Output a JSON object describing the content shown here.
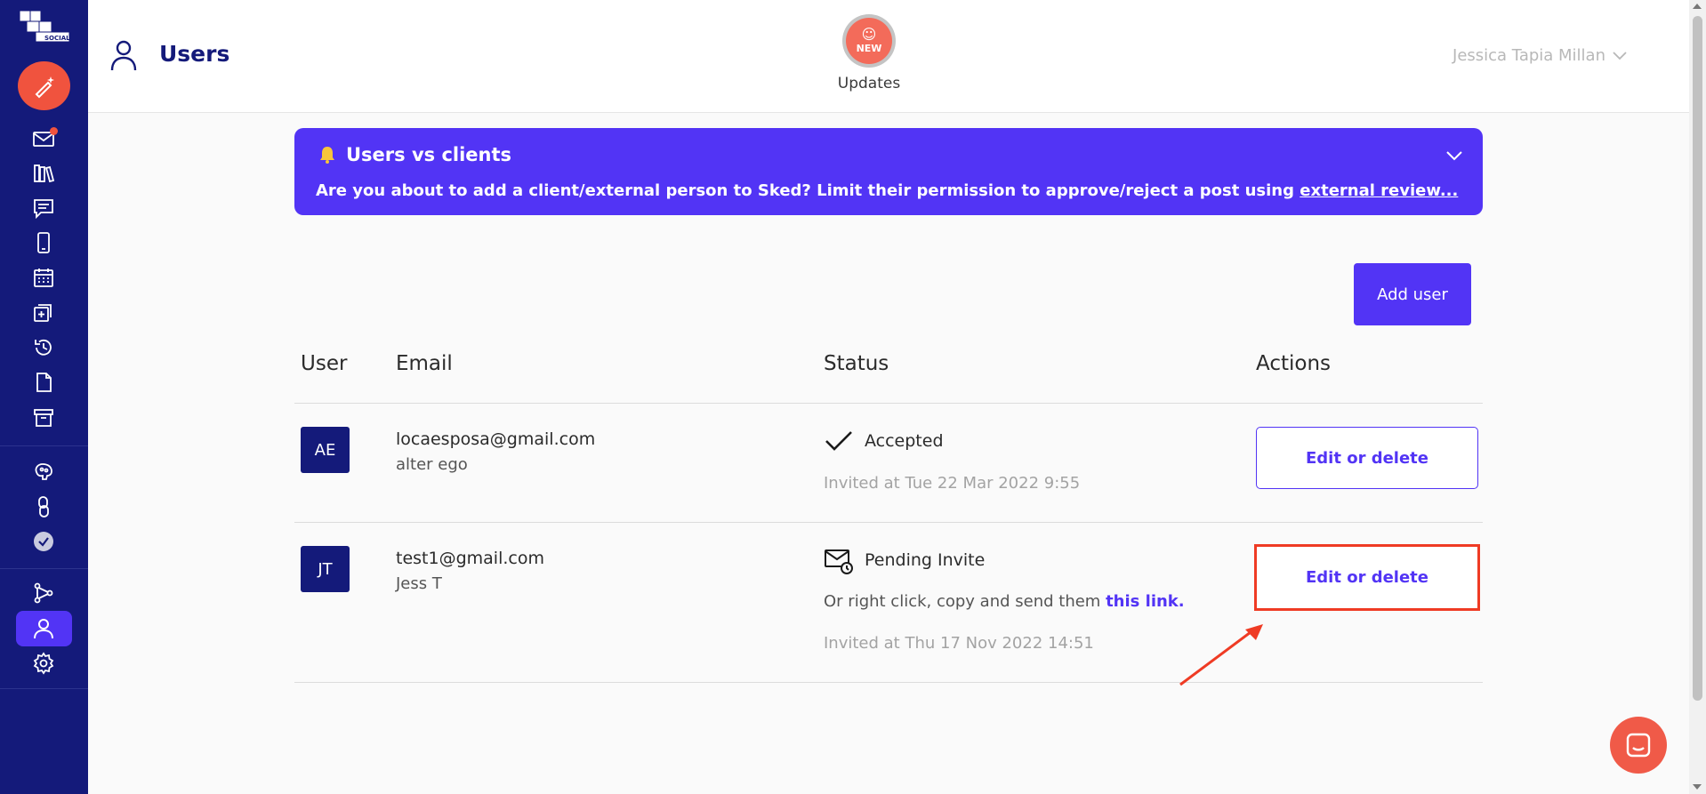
{
  "header": {
    "title": "Users",
    "updates_label": "Updates",
    "updates_badge": "NEW",
    "account_name": "Jessica Tapia Millan"
  },
  "banner": {
    "title": "Users vs clients",
    "text": "Are you about to add a client/external person to Sked? Limit their permission to approve/reject a post using ",
    "link": "external review..."
  },
  "toolbar": {
    "add_user_label": "Add user"
  },
  "table": {
    "columns": [
      "User",
      "Email",
      "Status",
      "Actions"
    ],
    "rows": [
      {
        "initials": "AE",
        "email": "locaesposa@gmail.com",
        "name": "alter ego",
        "status": "Accepted",
        "invited": "Invited at Tue 22 Mar 2022 9:55",
        "action": "Edit or delete"
      },
      {
        "initials": "JT",
        "email": "test1@gmail.com",
        "name": "Jess T",
        "status": "Pending Invite",
        "copy_text": "Or right click, copy and send them ",
        "copy_link": "this link.",
        "invited": "Invited at Thu 17 Nov 2022 14:51",
        "action": "Edit or delete"
      }
    ]
  },
  "sidebar": {
    "icons": [
      "inbox-icon",
      "library-icon",
      "comments-icon",
      "phone-preview-icon",
      "calendar-icon",
      "add-post-icon",
      "history-icon",
      "document-icon",
      "archive-icon",
      "insights-icon",
      "link-icon",
      "approval-icon",
      "integrations-icon",
      "users-icon",
      "settings-icon"
    ]
  },
  "colors": {
    "sidebar": "#141a7a",
    "accent": "#5234f5",
    "highlight": "#ef3b24",
    "compose": "#f0533e"
  }
}
